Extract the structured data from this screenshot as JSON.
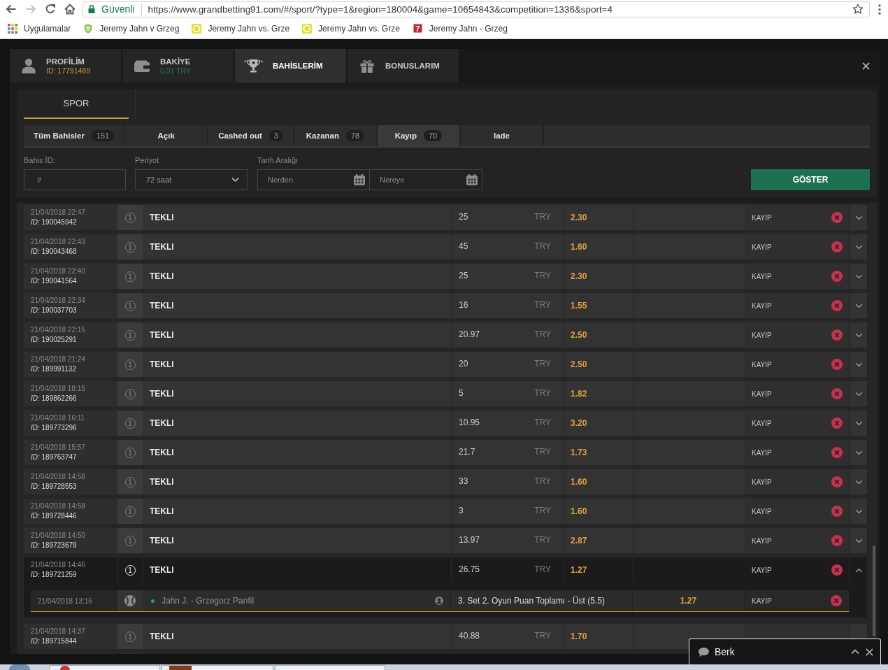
{
  "browser": {
    "nav_buttons": [
      {
        "kind": "back",
        "disabled": false
      },
      {
        "kind": "forward",
        "disabled": true
      },
      {
        "kind": "reload",
        "disabled": false
      },
      {
        "kind": "home",
        "disabled": false
      }
    ],
    "security_label": "Güvenli",
    "url": "https://www.grandbetting91.com/#/sport/?type=1&region=180004&game=10654843&competition=1336&sport=4",
    "bookmarks": [
      {
        "kind": "apps",
        "label": "Uygulamalar"
      },
      {
        "kind": "shield",
        "label": "Jeremy Jahn v Grzeg"
      },
      {
        "kind": "ring",
        "label": "Jeremy Jahn vs. Grze"
      },
      {
        "kind": "ring",
        "label": "Jeremy Jahn vs. Grze"
      },
      {
        "kind": "tile",
        "badge": "7",
        "label": "Jeremy Jahn - Grzeg"
      }
    ]
  },
  "account_tabs": [
    {
      "kind": "profile",
      "label": "PROFİLİM",
      "detail": "ID: 17791489",
      "selected": false
    },
    {
      "kind": "wallet",
      "label": "BAKİYE",
      "detail": "0.01 TRY",
      "selected": false
    },
    {
      "kind": "trophy",
      "label": "BAHİSLERİM",
      "selected": true
    },
    {
      "kind": "gift",
      "label": "BONUSLARIM",
      "selected": false
    }
  ],
  "section_tabs": [
    {
      "label": "SPOR",
      "selected": true
    }
  ],
  "filter_tabs": [
    {
      "label": "Tüm Bahisler",
      "count": "151",
      "selected": false
    },
    {
      "label": "Açık",
      "selected": false
    },
    {
      "label": "Cashed out",
      "count": "3",
      "selected": false
    },
    {
      "label": "Kazanan",
      "count": "78",
      "selected": false
    },
    {
      "label": "Kayıp",
      "count": "70",
      "selected": true
    },
    {
      "label": "Iade",
      "selected": false
    }
  ],
  "filters": {
    "bet_id": {
      "label": "Bahis İD:",
      "placeholder": "#"
    },
    "period": {
      "label": "Periyot",
      "value": "72 saat"
    },
    "date_range": {
      "label": "Tarih Aralığı",
      "from_placeholder": "Nerden",
      "to_placeholder": "Nereye"
    },
    "submit": "GÖSTER"
  },
  "bets": [
    {
      "date": "21/04/2018 22:47",
      "id": "*ID:* 190045942",
      "count": "1",
      "type": "TEKLI",
      "stake": "25",
      "currency": "TRY",
      "odds": "2.30",
      "status": "KAYIP",
      "lost": true,
      "expanded": false
    },
    {
      "date": "21/04/2018 22:43",
      "id": "*ID:* 190043468",
      "count": "1",
      "type": "TEKLI",
      "stake": "45",
      "currency": "TRY",
      "odds": "1.60",
      "status": "KAYIP",
      "lost": true,
      "expanded": false
    },
    {
      "date": "21/04/2018 22:40",
      "id": "*ID:* 190041564",
      "count": "1",
      "type": "TEKLI",
      "stake": "25",
      "currency": "TRY",
      "odds": "2.30",
      "status": "KAYIP",
      "lost": true,
      "expanded": false
    },
    {
      "date": "21/04/2018 22:34",
      "id": "*ID:* 190037703",
      "count": "1",
      "type": "TEKLI",
      "stake": "16",
      "currency": "TRY",
      "odds": "1.55",
      "status": "KAYIP",
      "lost": true,
      "expanded": false
    },
    {
      "date": "21/04/2018 22:15",
      "id": "*ID:* 190025291",
      "count": "1",
      "type": "TEKLI",
      "stake": "20.97",
      "currency": "TRY",
      "odds": "2.50",
      "status": "KAYIP",
      "lost": true,
      "expanded": false
    },
    {
      "date": "21/04/2018 21:24",
      "id": "*ID:* 189991132",
      "count": "1",
      "type": "TEKLI",
      "stake": "20",
      "currency": "TRY",
      "odds": "2.50",
      "status": "KAYIP",
      "lost": true,
      "expanded": false
    },
    {
      "date": "21/04/2018 18:15",
      "id": "*ID:* 189862266",
      "count": "1",
      "type": "TEKLI",
      "stake": "5",
      "currency": "TRY",
      "odds": "1.82",
      "status": "KAYIP",
      "lost": true,
      "expanded": false
    },
    {
      "date": "21/04/2018 16:11",
      "id": "*ID:* 189773296",
      "count": "1",
      "type": "TEKLI",
      "stake": "10.95",
      "currency": "TRY",
      "odds": "3.20",
      "status": "KAYIP",
      "lost": true,
      "expanded": false
    },
    {
      "date": "21/04/2018 15:57",
      "id": "*ID:* 189763747",
      "count": "1",
      "type": "TEKLI",
      "stake": "21.7",
      "currency": "TRY",
      "odds": "1.73",
      "status": "KAYIP",
      "lost": true,
      "expanded": false
    },
    {
      "date": "21/04/2018 14:58",
      "id": "*ID:* 189728553",
      "count": "1",
      "type": "TEKLI",
      "stake": "33",
      "currency": "TRY",
      "odds": "1.60",
      "status": "KAYIP",
      "lost": true,
      "expanded": false
    },
    {
      "date": "21/04/2018 14:58",
      "id": "*ID:* 189728446",
      "count": "1",
      "type": "TEKLI",
      "stake": "3",
      "currency": "TRY",
      "odds": "1.60",
      "status": "KAYIP",
      "lost": true,
      "expanded": false
    },
    {
      "date": "21/04/2018 14:50",
      "id": "*ID:* 189723679",
      "count": "1",
      "type": "TEKLI",
      "stake": "13.97",
      "currency": "TRY",
      "odds": "2.87",
      "status": "KAYIP",
      "lost": true,
      "expanded": false
    },
    {
      "date": "21/04/2018 14:46",
      "id": "*ID:* 189721259",
      "count": "1",
      "type": "TEKLI",
      "stake": "26.75",
      "currency": "TRY",
      "odds": "1.27",
      "status": "KAYIP",
      "lost": true,
      "expanded": true,
      "selections": [
        {
          "date": "21/04/2018 13:16",
          "kind": "tennis",
          "color": "#27a35f",
          "event": "Jahn J. - Grzegorz Panfil",
          "market": "3. Set 2. Oyun Puan Toplamı - Üst (5.5)",
          "odds": "1.27",
          "status": "KAYIP",
          "lost": true
        }
      ]
    },
    {
      "date": "21/04/2018 14:37",
      "id": "*ID:* 189715844",
      "count": "1",
      "type": "TEKLI",
      "stake": "40.88",
      "currency": "TRY",
      "odds": "1.70"
    }
  ],
  "chat": {
    "name": "Berk"
  }
}
